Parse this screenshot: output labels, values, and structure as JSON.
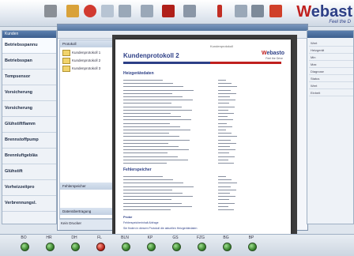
{
  "brand": {
    "name_a": "W",
    "name_b": "ebast",
    "tagline": "Feel the D"
  },
  "colors": {
    "accent": "#2d3f86",
    "brand_red": "#c0201e",
    "led_ok": "#2f7a24",
    "led_alarm": "#b01c12"
  },
  "toolbar": {
    "icons": [
      "scissors-icon",
      "tools-icon",
      "record-icon",
      "export-icon",
      "print-icon",
      "book-icon",
      "chart-icon",
      "info-icon",
      "table-icon",
      "alert-icon"
    ]
  },
  "left_nav": {
    "header": "Kunden",
    "items": [
      "Betriebsspannu",
      "Betriebsspan",
      "Tempsensor",
      "Vorsicherung",
      "Vorsicherung",
      "Glühstiftflamm",
      "Brennstoffpump",
      "Brennluftgebläs",
      "Glühstift",
      "Vorheizzeitpro",
      "Verbrennungsl."
    ]
  },
  "dialog": {
    "tree_header": "Protokoll",
    "tree_items": [
      "Kundenprotokoll 1",
      "Kundenprotokoll 2",
      "Kundenprotokoll 3"
    ],
    "section_a": "Fehlerspeicher",
    "section_b": "Datenübertragung",
    "bottom_label": "Kein Drucker"
  },
  "document": {
    "header_small": "Kundenprotokoll",
    "title": "Kundenprotokoll 2",
    "logo_a": "W",
    "logo_b": "ebasto",
    "logo_sub": "Feel the Drive",
    "section1": "Heizgerätedaten",
    "section2": "Fehlerspeicher",
    "section3": "Probe",
    "footer1": "Fehlerspeicherinhalt Abfrage",
    "footer2": "Sie finden in diesem Protokoll die aktuellen Heizgerätedaten"
  },
  "right_panel": {
    "rows": [
      "Wert",
      "Heizgerät",
      "Min",
      "Max",
      "Diagnose",
      "Status",
      "Wert",
      "Einheit"
    ]
  },
  "status_leds": [
    {
      "label": "BO",
      "state": "ok"
    },
    {
      "label": "HR",
      "state": "ok"
    },
    {
      "label": "DH",
      "state": "ok"
    },
    {
      "label": "FL",
      "state": "alarm"
    },
    {
      "label": "BLN",
      "state": "ok"
    },
    {
      "label": "KP",
      "state": "ok"
    },
    {
      "label": "GS",
      "state": "ok"
    },
    {
      "label": "FZG",
      "state": "ok"
    },
    {
      "label": "BG",
      "state": "ok"
    },
    {
      "label": "BP",
      "state": "ok"
    }
  ]
}
